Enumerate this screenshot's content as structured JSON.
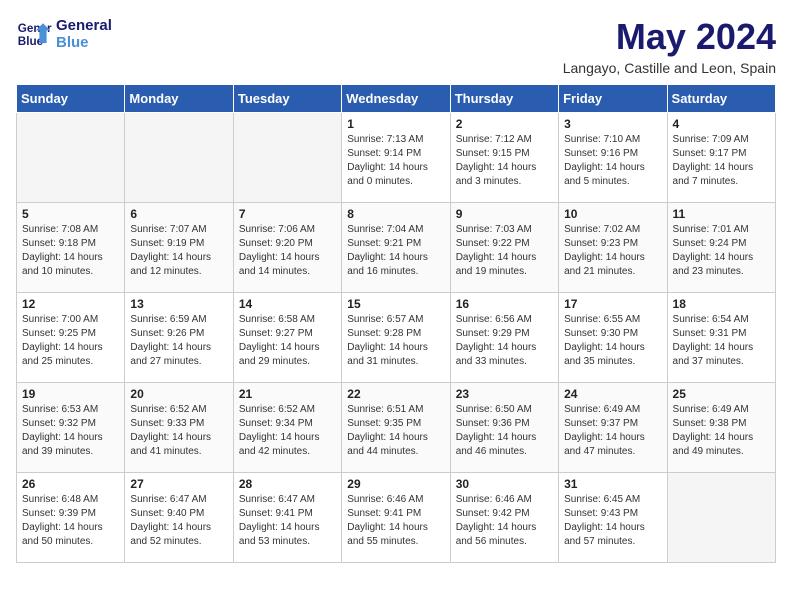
{
  "header": {
    "logo_line1": "General",
    "logo_line2": "Blue",
    "month_title": "May 2024",
    "location": "Langayo, Castille and Leon, Spain"
  },
  "days_of_week": [
    "Sunday",
    "Monday",
    "Tuesday",
    "Wednesday",
    "Thursday",
    "Friday",
    "Saturday"
  ],
  "weeks": [
    [
      {
        "day": "",
        "empty": true
      },
      {
        "day": "",
        "empty": true
      },
      {
        "day": "",
        "empty": true
      },
      {
        "day": "1",
        "sunrise": "7:13 AM",
        "sunset": "9:14 PM",
        "daylight": "14 hours and 0 minutes."
      },
      {
        "day": "2",
        "sunrise": "7:12 AM",
        "sunset": "9:15 PM",
        "daylight": "14 hours and 3 minutes."
      },
      {
        "day": "3",
        "sunrise": "7:10 AM",
        "sunset": "9:16 PM",
        "daylight": "14 hours and 5 minutes."
      },
      {
        "day": "4",
        "sunrise": "7:09 AM",
        "sunset": "9:17 PM",
        "daylight": "14 hours and 7 minutes."
      }
    ],
    [
      {
        "day": "5",
        "sunrise": "7:08 AM",
        "sunset": "9:18 PM",
        "daylight": "14 hours and 10 minutes."
      },
      {
        "day": "6",
        "sunrise": "7:07 AM",
        "sunset": "9:19 PM",
        "daylight": "14 hours and 12 minutes."
      },
      {
        "day": "7",
        "sunrise": "7:06 AM",
        "sunset": "9:20 PM",
        "daylight": "14 hours and 14 minutes."
      },
      {
        "day": "8",
        "sunrise": "7:04 AM",
        "sunset": "9:21 PM",
        "daylight": "14 hours and 16 minutes."
      },
      {
        "day": "9",
        "sunrise": "7:03 AM",
        "sunset": "9:22 PM",
        "daylight": "14 hours and 19 minutes."
      },
      {
        "day": "10",
        "sunrise": "7:02 AM",
        "sunset": "9:23 PM",
        "daylight": "14 hours and 21 minutes."
      },
      {
        "day": "11",
        "sunrise": "7:01 AM",
        "sunset": "9:24 PM",
        "daylight": "14 hours and 23 minutes."
      }
    ],
    [
      {
        "day": "12",
        "sunrise": "7:00 AM",
        "sunset": "9:25 PM",
        "daylight": "14 hours and 25 minutes."
      },
      {
        "day": "13",
        "sunrise": "6:59 AM",
        "sunset": "9:26 PM",
        "daylight": "14 hours and 27 minutes."
      },
      {
        "day": "14",
        "sunrise": "6:58 AM",
        "sunset": "9:27 PM",
        "daylight": "14 hours and 29 minutes."
      },
      {
        "day": "15",
        "sunrise": "6:57 AM",
        "sunset": "9:28 PM",
        "daylight": "14 hours and 31 minutes."
      },
      {
        "day": "16",
        "sunrise": "6:56 AM",
        "sunset": "9:29 PM",
        "daylight": "14 hours and 33 minutes."
      },
      {
        "day": "17",
        "sunrise": "6:55 AM",
        "sunset": "9:30 PM",
        "daylight": "14 hours and 35 minutes."
      },
      {
        "day": "18",
        "sunrise": "6:54 AM",
        "sunset": "9:31 PM",
        "daylight": "14 hours and 37 minutes."
      }
    ],
    [
      {
        "day": "19",
        "sunrise": "6:53 AM",
        "sunset": "9:32 PM",
        "daylight": "14 hours and 39 minutes."
      },
      {
        "day": "20",
        "sunrise": "6:52 AM",
        "sunset": "9:33 PM",
        "daylight": "14 hours and 41 minutes."
      },
      {
        "day": "21",
        "sunrise": "6:52 AM",
        "sunset": "9:34 PM",
        "daylight": "14 hours and 42 minutes."
      },
      {
        "day": "22",
        "sunrise": "6:51 AM",
        "sunset": "9:35 PM",
        "daylight": "14 hours and 44 minutes."
      },
      {
        "day": "23",
        "sunrise": "6:50 AM",
        "sunset": "9:36 PM",
        "daylight": "14 hours and 46 minutes."
      },
      {
        "day": "24",
        "sunrise": "6:49 AM",
        "sunset": "9:37 PM",
        "daylight": "14 hours and 47 minutes."
      },
      {
        "day": "25",
        "sunrise": "6:49 AM",
        "sunset": "9:38 PM",
        "daylight": "14 hours and 49 minutes."
      }
    ],
    [
      {
        "day": "26",
        "sunrise": "6:48 AM",
        "sunset": "9:39 PM",
        "daylight": "14 hours and 50 minutes."
      },
      {
        "day": "27",
        "sunrise": "6:47 AM",
        "sunset": "9:40 PM",
        "daylight": "14 hours and 52 minutes."
      },
      {
        "day": "28",
        "sunrise": "6:47 AM",
        "sunset": "9:41 PM",
        "daylight": "14 hours and 53 minutes."
      },
      {
        "day": "29",
        "sunrise": "6:46 AM",
        "sunset": "9:41 PM",
        "daylight": "14 hours and 55 minutes."
      },
      {
        "day": "30",
        "sunrise": "6:46 AM",
        "sunset": "9:42 PM",
        "daylight": "14 hours and 56 minutes."
      },
      {
        "day": "31",
        "sunrise": "6:45 AM",
        "sunset": "9:43 PM",
        "daylight": "14 hours and 57 minutes."
      },
      {
        "day": "",
        "empty": true
      }
    ]
  ],
  "labels": {
    "sunrise_prefix": "Sunrise: ",
    "sunset_prefix": "Sunset: ",
    "daylight_prefix": "Daylight: "
  }
}
